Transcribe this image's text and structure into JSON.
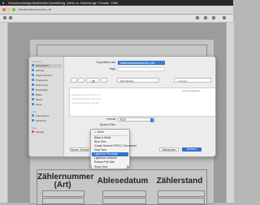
{
  "menubar": {
    "apple": "",
    "items": [
      "Vorschau",
      "Ablage",
      "Bearbeiten",
      "Darstellung",
      "Gehe zu",
      "Werkzeuge",
      "Fenster",
      "Hilfe"
    ]
  },
  "app": {
    "title": "Zählerablesenkarte.pdf"
  },
  "document": {
    "headers": [
      "Zählernummer\n(Art)",
      "Ablesedatum",
      "Zählerstand"
    ]
  },
  "dialog": {
    "export_label": "Exportieren als:",
    "export_value": "Zählerablesekarte2021.pdf",
    "tags_label": "Tags:",
    "location_value": "Schreibtisch",
    "search_placeholder": "Suchen",
    "format_label": "Format:",
    "format_value": "PDF",
    "quartz_label": "Quartz-Filter:",
    "new_folder_button": "Neuer Ordner",
    "cancel_button": "Abbrechen",
    "save_button": "Sichern",
    "file_list_header": "Änderungsdatum",
    "sidebar": {
      "favorites_header": "Favoriten",
      "favorites": [
        "Schreibtisch",
        "AirDrop",
        "Zuletzt benutzt",
        "Programme",
        "Dokumente",
        "Downloads",
        "Bilder",
        "Musik",
        "Filme"
      ],
      "locations_header": "Orte",
      "locations": [
        "iCloud Drive",
        "Netzwerk"
      ],
      "tags_header": "Tags",
      "tags": [
        "Wichtig"
      ]
    },
    "files": [
      "Zählerablesekarte2019.pdf",
      "Zählerablesekarte2020.pdf",
      "Zählerablesekarte_alt.pdf"
    ]
  },
  "dropdown": {
    "items": [
      "✓ Ohne",
      "Black & White",
      "Blue Tone",
      "Create Generic PDF/X-3 Document",
      "Gray Tone",
      "Lightness Decrease",
      "Lightness Increase",
      "Reduce File Size",
      "Sepia Tone"
    ],
    "selected_index": 5
  },
  "colors": {
    "accent": "#2f73d0",
    "menubar": "#2b2b2b"
  }
}
